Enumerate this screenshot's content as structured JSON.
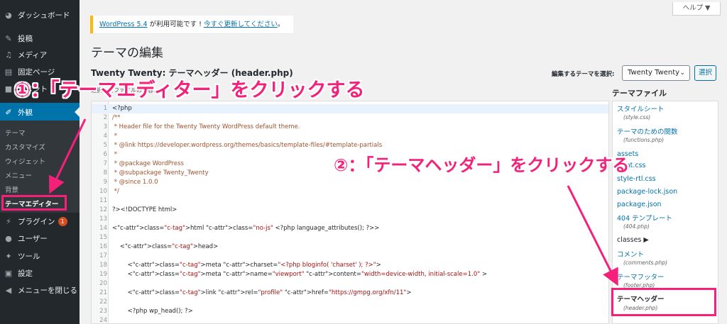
{
  "sidebar": {
    "items": [
      {
        "label": "ダッシュボード",
        "icon": "dashboard-icon"
      },
      {
        "label": "投稿",
        "icon": "pin-icon"
      },
      {
        "label": "メディア",
        "icon": "media-icon"
      },
      {
        "label": "固定ページ",
        "icon": "page-icon"
      },
      {
        "label": "コメント",
        "icon": "comment-icon"
      },
      {
        "label": "外観",
        "icon": "brush-icon"
      },
      {
        "label": "プラグイン",
        "icon": "plugin-icon",
        "badge": "1"
      },
      {
        "label": "ユーザー",
        "icon": "user-icon"
      },
      {
        "label": "ツール",
        "icon": "wrench-icon"
      },
      {
        "label": "設定",
        "icon": "settings-icon"
      },
      {
        "label": "メニューを閉じる",
        "icon": "collapse-icon"
      }
    ],
    "submenu": [
      "テーマ",
      "カスタマイズ",
      "ウィジェット",
      "メニュー",
      "背景",
      "テーマエディター"
    ]
  },
  "help_button": "ヘルプ ▼",
  "notice": {
    "link1": "WordPress 5.4",
    "text": " が利用可能です ! ",
    "link2": "今すぐ更新してください",
    "end": "。"
  },
  "page_title": "テーマの編集",
  "file_title": "Twenty Twenty: テーマヘッダー (header.php)",
  "select_label": "編集するテーマを選択:",
  "theme_select_value": "Twenty Twenty",
  "select_button": "選択",
  "hidden_line": "選択したファイルの内容:",
  "code_lines": [
    "<?php",
    "/**",
    " * Header file for the Twenty Twenty WordPress default theme.",
    " *",
    " * @link https://developer.wordpress.org/themes/basics/template-files/#template-partials",
    " *",
    " * @package WordPress",
    " * @subpackage Twenty_Twenty",
    " * @since 1.0.0",
    " */",
    "",
    "?><!DOCTYPE html>",
    "",
    "<html class=\"no-js\" <?php language_attributes(); ?>>",
    "",
    "\t<head>",
    "",
    "\t\t<meta charset=\"<?php bloginfo( 'charset' ); ?>\">",
    "\t\t<meta name=\"viewport\" content=\"width=device-width, initial-scale=1.0\" >",
    "",
    "\t\t<link rel=\"profile\" href=\"https://gmpg.org/xfn/11\">",
    "",
    "\t\t<?php wp_head(); ?>",
    ""
  ],
  "files_heading": "テーマファイル",
  "files": [
    {
      "name": "スタイルシート",
      "sub": "(style.css)"
    },
    {
      "name": "テーマのための関数",
      "sub": "(functions.php)"
    },
    {
      "name": "assets",
      "sub": ""
    },
    {
      "name": "print.css",
      "sub": ""
    },
    {
      "name": "style-rtl.css",
      "sub": ""
    },
    {
      "name": "package-lock.json",
      "sub": ""
    },
    {
      "name": "package.json",
      "sub": ""
    },
    {
      "name": "404 テンプレート",
      "sub": "(404.php)"
    },
    {
      "name": "classes ▶",
      "sub": ""
    },
    {
      "name": "コメント",
      "sub": "(comments.php)"
    },
    {
      "name": "テーマフッター",
      "sub": "(footer.php)"
    },
    {
      "name": "テーマヘッダー",
      "sub": "(header.php)"
    }
  ],
  "annotations": {
    "step1": "①：「テーマエディター」をクリックする",
    "step2": "②：「テーマヘッダー」をクリックする"
  },
  "colors": {
    "sidebar": "#23282d",
    "accent": "#0073aa",
    "annotation": "#f4207a",
    "notice": "#ffb900"
  }
}
